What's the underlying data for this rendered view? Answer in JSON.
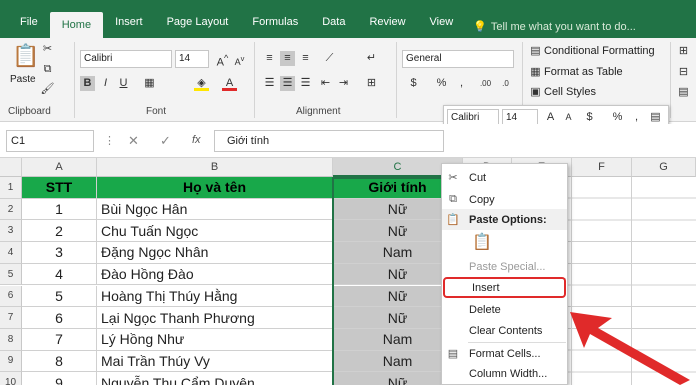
{
  "tabs": [
    "File",
    "Home",
    "Insert",
    "Page Layout",
    "Formulas",
    "Data",
    "Review",
    "View"
  ],
  "tell_me": "Tell me what you want to do...",
  "ribbon": {
    "paste_label": "Paste",
    "clipboard_label": "Clipboard",
    "font_label": "Font",
    "alignment_label": "Alignment",
    "font_name": "Calibri",
    "font_size": "14",
    "number_format": "General",
    "conditional_formatting": "Conditional Formatting",
    "format_as_table": "Format as Table",
    "cell_styles": "Cell Styles"
  },
  "formula_bar": {
    "name_box": "C1",
    "fx": "fx",
    "content": "Giới tính"
  },
  "columns": [
    "A",
    "B",
    "C",
    "D",
    "E",
    "F",
    "G"
  ],
  "rows": [
    "1",
    "2",
    "3",
    "4",
    "5",
    "6",
    "7",
    "8",
    "9",
    "10"
  ],
  "headers": {
    "stt": "STT",
    "name": "Họ và tên",
    "gender": "Giới tính"
  },
  "data_rows": [
    {
      "stt": "1",
      "name": "Bùi Ngọc Hân",
      "gender": "Nữ"
    },
    {
      "stt": "2",
      "name": "Chu Tuấn Ngọc",
      "gender": "Nữ"
    },
    {
      "stt": "3",
      "name": "Đặng Ngọc Nhân",
      "gender": "Nam"
    },
    {
      "stt": "4",
      "name": "Đào Hồng Đào",
      "gender": "Nữ"
    },
    {
      "stt": "5",
      "name": "Hoàng Thị Thúy Hằng",
      "gender": "Nữ"
    },
    {
      "stt": "6",
      "name": "Lại Ngọc Thanh Phương",
      "gender": "Nữ"
    },
    {
      "stt": "7",
      "name": "Lý Hồng Như",
      "gender": "Nam"
    },
    {
      "stt": "8",
      "name": "Mai Trần Thúy Vy",
      "gender": "Nam"
    },
    {
      "stt": "9",
      "name": "Nguyễn Thụ Cẩm Duyên",
      "gender": "Nữ"
    }
  ],
  "mini_toolbar": {
    "font": "Calibri",
    "size": "14"
  },
  "context_menu": {
    "cut": "Cut",
    "copy": "Copy",
    "paste_options": "Paste Options:",
    "paste_special": "Paste Special...",
    "insert": "Insert",
    "delete": "Delete",
    "clear_contents": "Clear Contents",
    "format_cells": "Format Cells...",
    "column_width": "Column Width..."
  },
  "colors": {
    "excel_green": "#217346",
    "header_fill": "#18a84a",
    "highlight": "#e02a2a"
  }
}
